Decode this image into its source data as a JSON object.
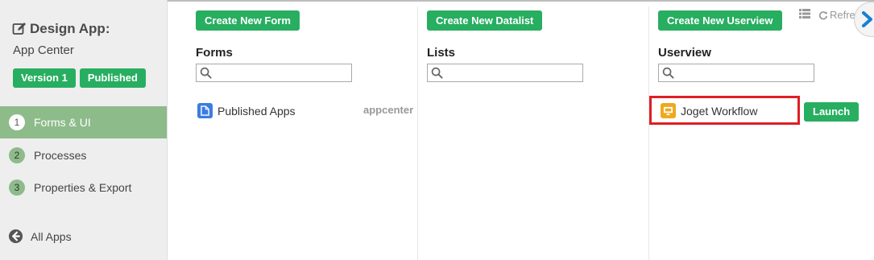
{
  "sidebar": {
    "title": "Design App:",
    "app_name": "App Center",
    "badges": [
      "Version 1",
      "Published"
    ],
    "steps": [
      {
        "num": "1",
        "label": "Forms & UI"
      },
      {
        "num": "2",
        "label": "Processes"
      },
      {
        "num": "3",
        "label": "Properties & Export"
      }
    ],
    "all_apps": "All Apps"
  },
  "columns": {
    "forms": {
      "button": "Create New Form",
      "title": "Forms",
      "items": [
        {
          "label": "Published Apps",
          "meta": "appcenter"
        }
      ]
    },
    "lists": {
      "button": "Create New Datalist",
      "title": "Lists"
    },
    "userview": {
      "button": "Create New Userview",
      "title": "Userview",
      "items": [
        {
          "label": "Joget Workflow",
          "launch": "Launch"
        }
      ]
    }
  },
  "toolbar": {
    "refresh": "Refre"
  },
  "colors": {
    "accent_green": "#27ae60",
    "step_green": "#8dbb8a",
    "highlight_red": "#e01e24"
  }
}
